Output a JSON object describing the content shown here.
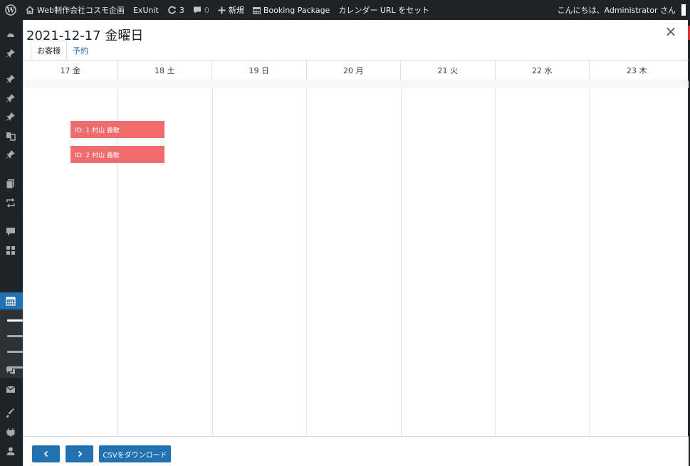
{
  "admin_bar": {
    "site_name": "Web制作会社コスモ企画",
    "exunit": "ExUnit",
    "updates_count": "3",
    "comments_count": "0",
    "new_label": "新規",
    "booking_package": "Booking Package",
    "calendar_url": "カレンダー URL をセット",
    "greeting": "こんにちは、Administrator さん"
  },
  "modal": {
    "title": "2021-12-17 金曜日",
    "close": "×",
    "tabs": [
      {
        "label": "お客様",
        "active": true
      },
      {
        "label": "予約",
        "active": false
      }
    ]
  },
  "calendar": {
    "days": [
      "17 金",
      "18 土",
      "19 日",
      "20 月",
      "21 火",
      "22 水",
      "23 木"
    ],
    "bookings": [
      {
        "label": "ID: 1 村山 義敏"
      },
      {
        "label": "ID: 2 村山 義敏"
      }
    ],
    "booking_color": "#f06b6b"
  },
  "footer": {
    "prev": "‹",
    "next": "›",
    "csv": "CSVをダウンロード"
  },
  "colors": {
    "accent": "#2271b1",
    "adminbar": "#1d2327"
  },
  "icons": [
    "wordpress-icon",
    "home-icon",
    "updates-icon",
    "comment-icon",
    "plus-icon",
    "calendar-icon",
    "close-icon",
    "chevron-left-icon",
    "chevron-right-icon"
  ]
}
